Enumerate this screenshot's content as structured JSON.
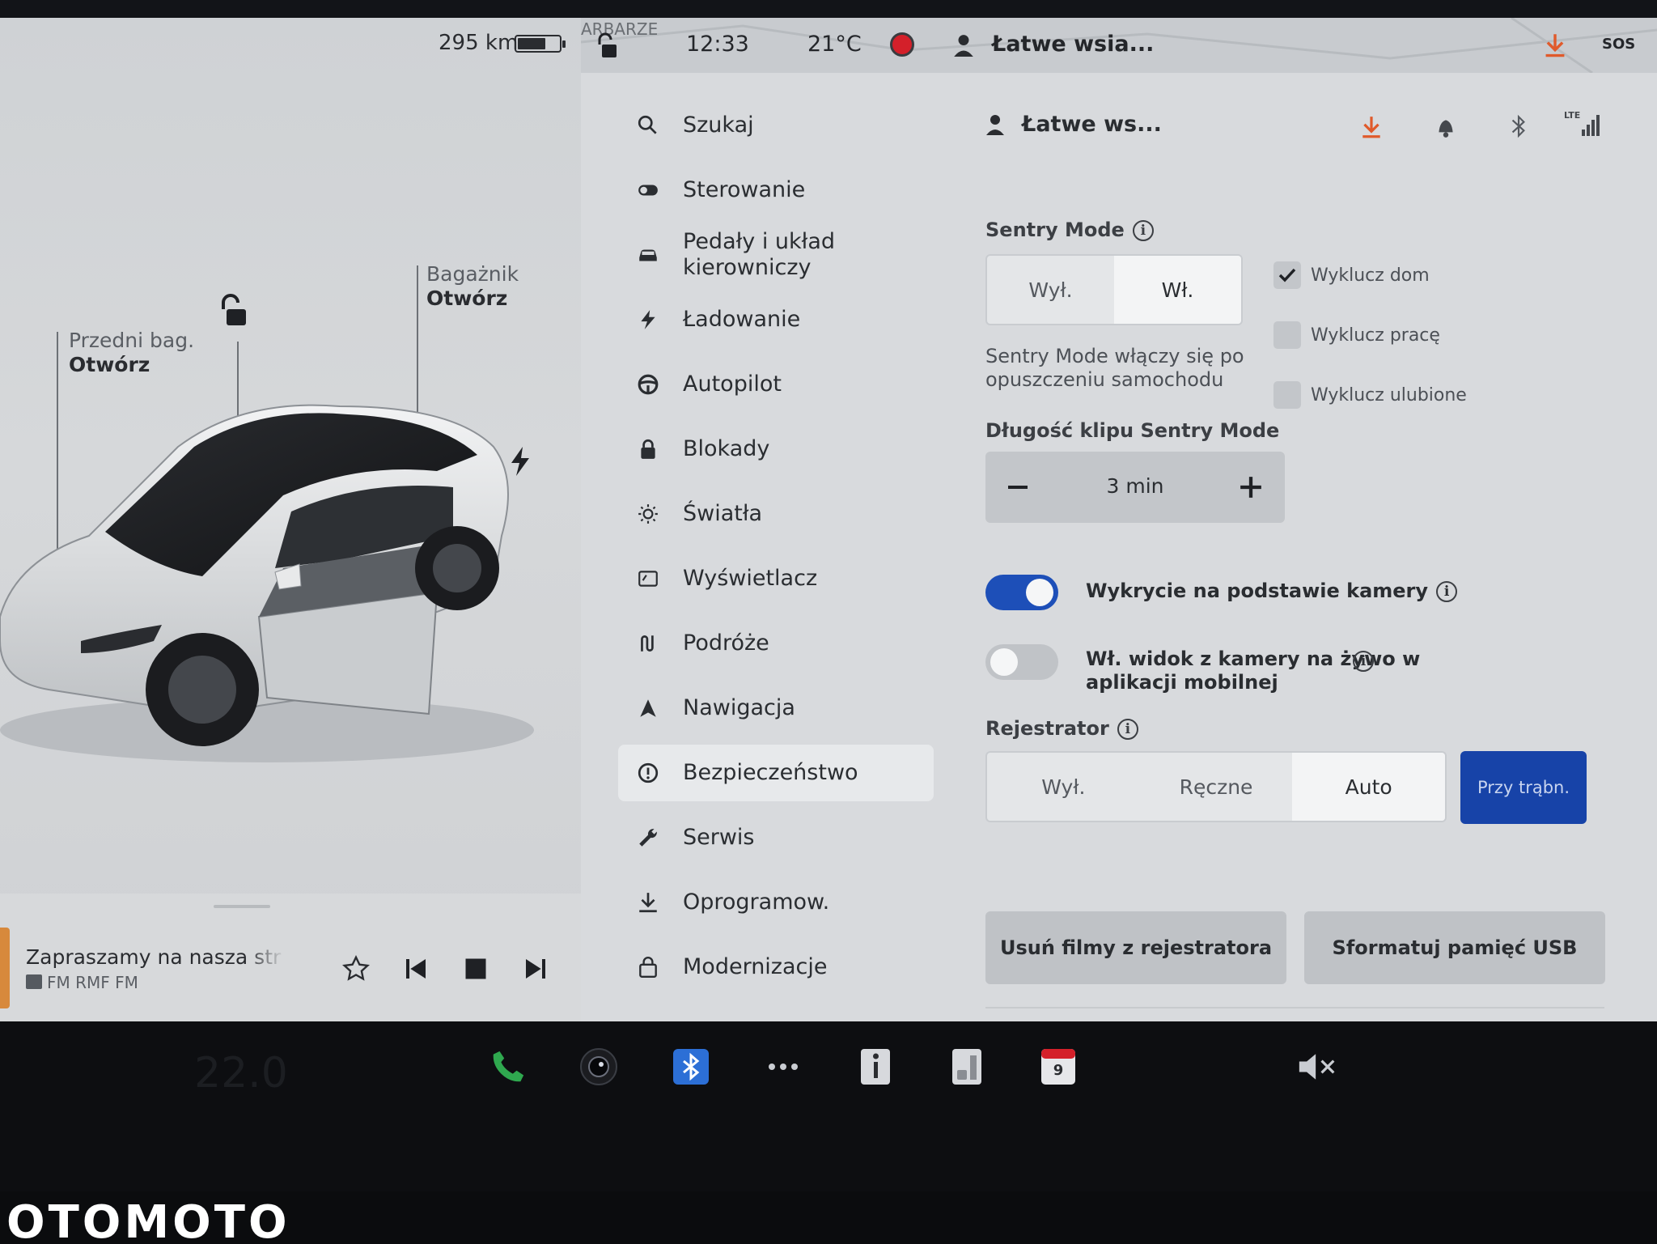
{
  "status": {
    "range": "295 km",
    "map_label": "ARBARZE",
    "time": "12:33",
    "temperature": "21°C",
    "profile": "Łatwe wsia...",
    "sos": "SOS",
    "lte": "LTE"
  },
  "car": {
    "front_trunk": {
      "title": "Przedni bag.",
      "action": "Otwórz"
    },
    "trunk": {
      "title": "Bagażnik",
      "action": "Otwórz"
    }
  },
  "media": {
    "title": "Zapraszamy na nasza str",
    "station": "FM RMF FM"
  },
  "menu": [
    {
      "label": "Szukaj",
      "icon": "search-icon"
    },
    {
      "label": "Sterowanie",
      "icon": "toggle-icon"
    },
    {
      "label": "Pedały i układ kierowniczy",
      "icon": "car-icon"
    },
    {
      "label": "Ładowanie",
      "icon": "bolt-icon"
    },
    {
      "label": "Autopilot",
      "icon": "steering-wheel-icon"
    },
    {
      "label": "Blokady",
      "icon": "lock-icon"
    },
    {
      "label": "Światła",
      "icon": "sun-icon"
    },
    {
      "label": "Wyświetlacz",
      "icon": "display-icon"
    },
    {
      "label": "Podróże",
      "icon": "route-icon"
    },
    {
      "label": "Nawigacja",
      "icon": "navigation-icon"
    },
    {
      "label": "Bezpieczeństwo",
      "icon": "alert-icon",
      "active": true
    },
    {
      "label": "Serwis",
      "icon": "wrench-icon"
    },
    {
      "label": "Oprogramow.",
      "icon": "download-icon"
    },
    {
      "label": "Modernizacje",
      "icon": "bag-icon"
    }
  ],
  "content": {
    "profile": "Łatwe ws...",
    "sentry": {
      "title": "Sentry Mode",
      "options": [
        "Wył.",
        "Wł."
      ],
      "selected": "Wł.",
      "description": "Sentry Mode włączy się po opuszczeniu samochodu",
      "exclusions": [
        {
          "label": "Wyklucz dom",
          "checked": true
        },
        {
          "label": "Wyklucz pracę",
          "checked": false
        },
        {
          "label": "Wyklucz ulubione",
          "checked": false
        }
      ]
    },
    "clip": {
      "title": "Długość klipu Sentry Mode",
      "value": "3 min"
    },
    "toggles": [
      {
        "label": "Wykrycie na podstawie kamery",
        "on": true
      },
      {
        "label": "Wł. widok z kamery na żywo w aplikacji mobilnej",
        "on": false
      }
    ],
    "recorder": {
      "title": "Rejestrator",
      "options": [
        "Wył.",
        "Ręczne",
        "Auto"
      ],
      "selected": "Auto",
      "horn_option": "Przy trąbn."
    },
    "actions": {
      "delete": "Usuń filmy z rejestratora",
      "format": "Sformatuj pamięć USB"
    }
  },
  "dock": {
    "calendar_day": "9",
    "cabin_temp": "22.0"
  },
  "watermark": "OTOMOTO",
  "colors": {
    "accent_blue": "#1d4fb8",
    "horn_blue": "#1743a8",
    "phone_green": "#2fa84f",
    "record_red": "#d4202a",
    "download_orange": "#e05a2b"
  }
}
